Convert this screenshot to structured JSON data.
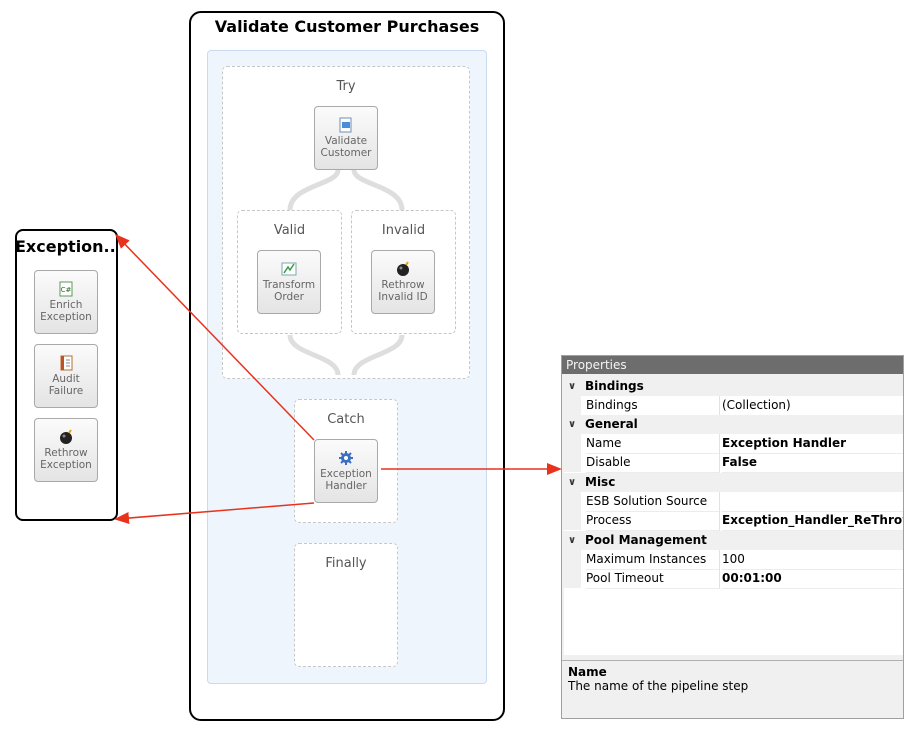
{
  "workflow": {
    "title": "Validate Customer Purchases",
    "try_label": "Try",
    "catch_label": "Catch",
    "finally_label": "Finally",
    "validate_activity": "Validate Customer",
    "valid_branch": {
      "label": "Valid",
      "activity": "Transform Order"
    },
    "invalid_branch": {
      "label": "Invalid",
      "activity": "Rethrow Invalid ID"
    },
    "catch_activity": "Exception Handler"
  },
  "exception_workflow": {
    "title": "Exception...",
    "steps": [
      "Enrich Exception",
      "Audit Failure",
      "Rethrow Exception"
    ]
  },
  "properties": {
    "header": "Properties",
    "categories": [
      {
        "name": "Bindings",
        "rows": [
          {
            "key": "Bindings",
            "value": "(Collection)",
            "bold": false
          }
        ]
      },
      {
        "name": "General",
        "rows": [
          {
            "key": "Name",
            "value": "Exception Handler",
            "bold": true
          },
          {
            "key": "Disable",
            "value": "False",
            "bold": true
          }
        ]
      },
      {
        "name": "Misc",
        "rows": [
          {
            "key": "ESB Solution Source",
            "value": "",
            "bold": false
          },
          {
            "key": "Process",
            "value": "Exception_Handler_ReThrow",
            "bold": true
          }
        ]
      },
      {
        "name": "Pool Management",
        "rows": [
          {
            "key": "Maximum Instances",
            "value": "100",
            "bold": false
          },
          {
            "key": "Pool Timeout",
            "value": "00:01:00",
            "bold": true
          }
        ]
      }
    ],
    "description_title": "Name",
    "description_text": "The name of the pipeline step"
  },
  "colors": {
    "arrow": "#e8321c",
    "sequence_bg": "#eef5fc",
    "panel_header": "#6d6d6d"
  }
}
